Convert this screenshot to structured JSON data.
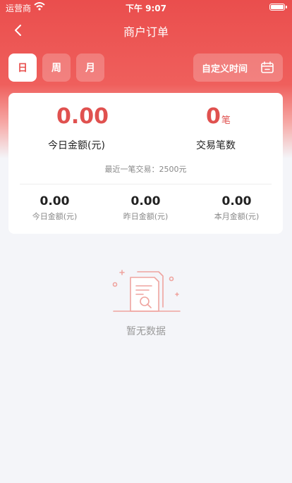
{
  "status_bar": {
    "carrier": "运营商",
    "time": "下午 9:07"
  },
  "nav": {
    "title": "商户订单"
  },
  "filters": {
    "period_tabs": [
      {
        "label": "日",
        "active": true
      },
      {
        "label": "周",
        "active": false
      },
      {
        "label": "月",
        "active": false
      }
    ],
    "custom_label": "自定义时间"
  },
  "summary": {
    "today_amount": "0.00",
    "today_amount_label": "今日金额(元)",
    "transaction_count": "0",
    "transaction_unit": "笔",
    "transaction_count_label": "交易笔数",
    "last_transaction": "最近一笔交易：2500元"
  },
  "stats": [
    {
      "value": "0.00",
      "label": "今日金额(元)"
    },
    {
      "value": "0.00",
      "label": "昨日金额(元)"
    },
    {
      "value": "0.00",
      "label": "本月金额(元)"
    }
  ],
  "empty_state": {
    "text": "暂无数据"
  },
  "colors": {
    "accent": "#e8504e",
    "background": "#f4f5f9"
  }
}
